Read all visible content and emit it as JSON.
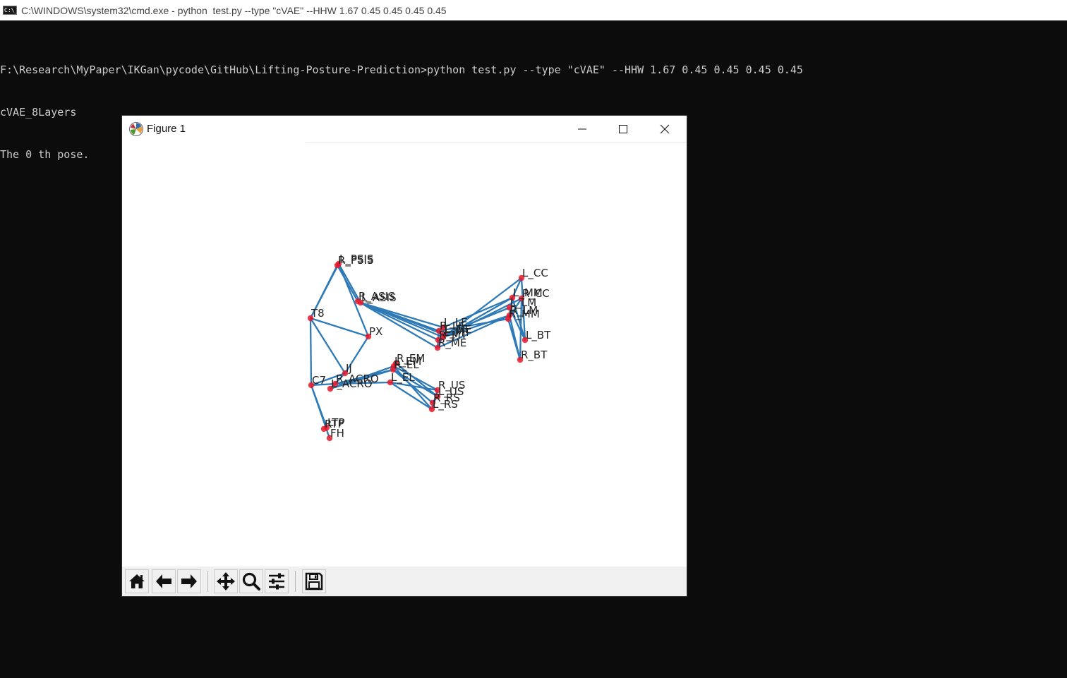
{
  "console_window": {
    "title": "C:\\WINDOWS\\system32\\cmd.exe - python  test.py --type \"cVAE\" --HHW 1.67 0.45 0.45 0.45 0.45",
    "icon": "cmd-icon",
    "icon_text": "C:\\_",
    "lines": [
      "F:\\Research\\MyPaper\\IKGan\\pycode\\GitHub\\Lifting-Posture-Prediction>python test.py --type \"cVAE\" --HHW 1.67 0.45 0.45 0.45 0.45",
      "cVAE_8Layers",
      "The 0 th pose."
    ]
  },
  "figure_window": {
    "title": "Figure 1",
    "app_icon": "matplotlib-icon",
    "controls": {
      "minimize": "minimize-icon",
      "maximize": "maximize-icon",
      "close": "close-icon"
    },
    "toolbar": [
      {
        "name": "home",
        "icon": "home-icon"
      },
      {
        "name": "back",
        "icon": "arrow-left-icon"
      },
      {
        "name": "forward",
        "icon": "arrow-right-icon"
      },
      {
        "name": "pan",
        "icon": "move-icon"
      },
      {
        "name": "zoom",
        "icon": "zoom-icon"
      },
      {
        "name": "subplots",
        "icon": "sliders-icon"
      },
      {
        "name": "save",
        "icon": "save-icon"
      }
    ]
  },
  "chart_data": {
    "type": "scatter",
    "title": "",
    "xlabel": "",
    "ylabel": "",
    "axes_visible": false,
    "grid": false,
    "point_color": "#e8192c",
    "line_color": "#2e7ab6",
    "joints": [
      {
        "name": "L_PSIS",
        "x": 0.0,
        "y": 0.0
      },
      {
        "name": "R_PSIS",
        "x": 0.0,
        "y": 0.0
      },
      {
        "name": "L_ASIS",
        "x": 0.0,
        "y": 0.0
      },
      {
        "name": "R_ASIS",
        "x": 0.0,
        "y": 0.0
      },
      {
        "name": "T8",
        "x": 0.0,
        "y": 0.0
      },
      {
        "name": "PX",
        "x": 0.0,
        "y": 0.0
      },
      {
        "name": "IJ",
        "x": 0.0,
        "y": 0.0
      },
      {
        "name": "C7",
        "x": 0.0,
        "y": 0.0
      },
      {
        "name": "R_ACRO",
        "x": 0.0,
        "y": 0.0
      },
      {
        "name": "L_ACRO",
        "x": 0.0,
        "y": 0.0
      },
      {
        "name": "RTP",
        "x": 0.0,
        "y": 0.0
      },
      {
        "name": "LTP",
        "x": 0.0,
        "y": 0.0
      },
      {
        "name": "FH",
        "x": 0.0,
        "y": 0.0
      },
      {
        "name": "R_EM",
        "x": 0.0,
        "y": 0.0
      },
      {
        "name": "L_EM",
        "x": 0.0,
        "y": 0.0
      },
      {
        "name": "R_EL",
        "x": 0.0,
        "y": 0.0
      },
      {
        "name": "L_EL",
        "x": 0.0,
        "y": 0.0
      },
      {
        "name": "R_US",
        "x": 0.0,
        "y": 0.0
      },
      {
        "name": "L_US",
        "x": 0.0,
        "y": 0.0
      },
      {
        "name": "R_RS",
        "x": 0.0,
        "y": 0.0
      },
      {
        "name": "L_RS",
        "x": 0.0,
        "y": 0.0
      },
      {
        "name": "L_LE",
        "x": 0.0,
        "y": 0.0
      },
      {
        "name": "R_LE",
        "x": 0.0,
        "y": 0.0
      },
      {
        "name": "L_ME",
        "x": 0.0,
        "y": 0.0
      },
      {
        "name": "R_ME",
        "x": 0.0,
        "y": 0.0
      },
      {
        "name": "R_MT",
        "x": 0.0,
        "y": 0.0
      },
      {
        "name": "L_MT",
        "x": 0.0,
        "y": 0.0
      },
      {
        "name": "L_CC",
        "x": 0.0,
        "y": 0.0
      },
      {
        "name": "R_CC",
        "x": 0.0,
        "y": 0.0
      },
      {
        "name": "L_MM",
        "x": 0.0,
        "y": 0.0
      },
      {
        "name": "R_MM",
        "x": 0.0,
        "y": 0.0
      },
      {
        "name": "L_LM",
        "x": 0.0,
        "y": 0.0
      },
      {
        "name": "R_LM",
        "x": 0.0,
        "y": 0.0
      },
      {
        "name": "L_BT",
        "x": 0.0,
        "y": 0.0
      },
      {
        "name": "R_BT",
        "x": 0.0,
        "y": 0.0
      }
    ],
    "segments": [
      [
        "R_PSIS",
        "T8"
      ],
      [
        "L_PSIS",
        "T8"
      ],
      [
        "R_PSIS",
        "R_ASIS"
      ],
      [
        "L_PSIS",
        "L_ASIS"
      ],
      [
        "L_PSIS",
        "PX"
      ],
      [
        "T8",
        "PX"
      ],
      [
        "T8",
        "C7"
      ],
      [
        "T8",
        "IJ"
      ],
      [
        "C7",
        "IJ"
      ],
      [
        "C7",
        "FH"
      ],
      [
        "C7",
        "LTP"
      ],
      [
        "PX",
        "IJ"
      ],
      [
        "IJ",
        "L_ACRO"
      ],
      [
        "C7",
        "R_ACRO"
      ],
      [
        "R_ACRO",
        "L_EL"
      ],
      [
        "R_ACRO",
        "R_EL"
      ],
      [
        "L_ACRO",
        "R_EL"
      ],
      [
        "L_ACRO",
        "L_EM"
      ],
      [
        "L_EM",
        "R_US"
      ],
      [
        "L_EM",
        "L_RS"
      ],
      [
        "R_EL",
        "L_US"
      ],
      [
        "R_EL",
        "R_RS"
      ],
      [
        "L_EL",
        "L_RS"
      ],
      [
        "L_EL",
        "R_US"
      ],
      [
        "R_EM",
        "L_US"
      ],
      [
        "R_US",
        "L_RS"
      ],
      [
        "L_US",
        "R_RS"
      ],
      [
        "L_ASIS",
        "L_LE"
      ],
      [
        "L_ASIS",
        "R_LE"
      ],
      [
        "R_ASIS",
        "L_ME"
      ],
      [
        "R_ASIS",
        "R_ME"
      ],
      [
        "L_ASIS",
        "R_MT"
      ],
      [
        "R_ASIS",
        "L_MT"
      ],
      [
        "L_LE",
        "R_LE"
      ],
      [
        "L_ME",
        "R_ME"
      ],
      [
        "R_LE",
        "R_ME"
      ],
      [
        "L_LE",
        "L_MM"
      ],
      [
        "L_ME",
        "L_LM"
      ],
      [
        "R_LE",
        "R_MM"
      ],
      [
        "R_ME",
        "R_LM"
      ],
      [
        "L_MT",
        "L_CC"
      ],
      [
        "R_MT",
        "R_CC"
      ],
      [
        "L_MT",
        "R_LM"
      ],
      [
        "R_MT",
        "L_MM"
      ],
      [
        "L_CC",
        "L_MM"
      ],
      [
        "L_CC",
        "L_BT"
      ],
      [
        "R_CC",
        "R_MM"
      ],
      [
        "R_CC",
        "R_BT"
      ],
      [
        "L_MM",
        "L_BT"
      ],
      [
        "R_MM",
        "R_BT"
      ],
      [
        "L_LM",
        "L_BT"
      ],
      [
        "R_LM",
        "R_BT"
      ],
      [
        "L_MM",
        "R_LM"
      ]
    ]
  }
}
